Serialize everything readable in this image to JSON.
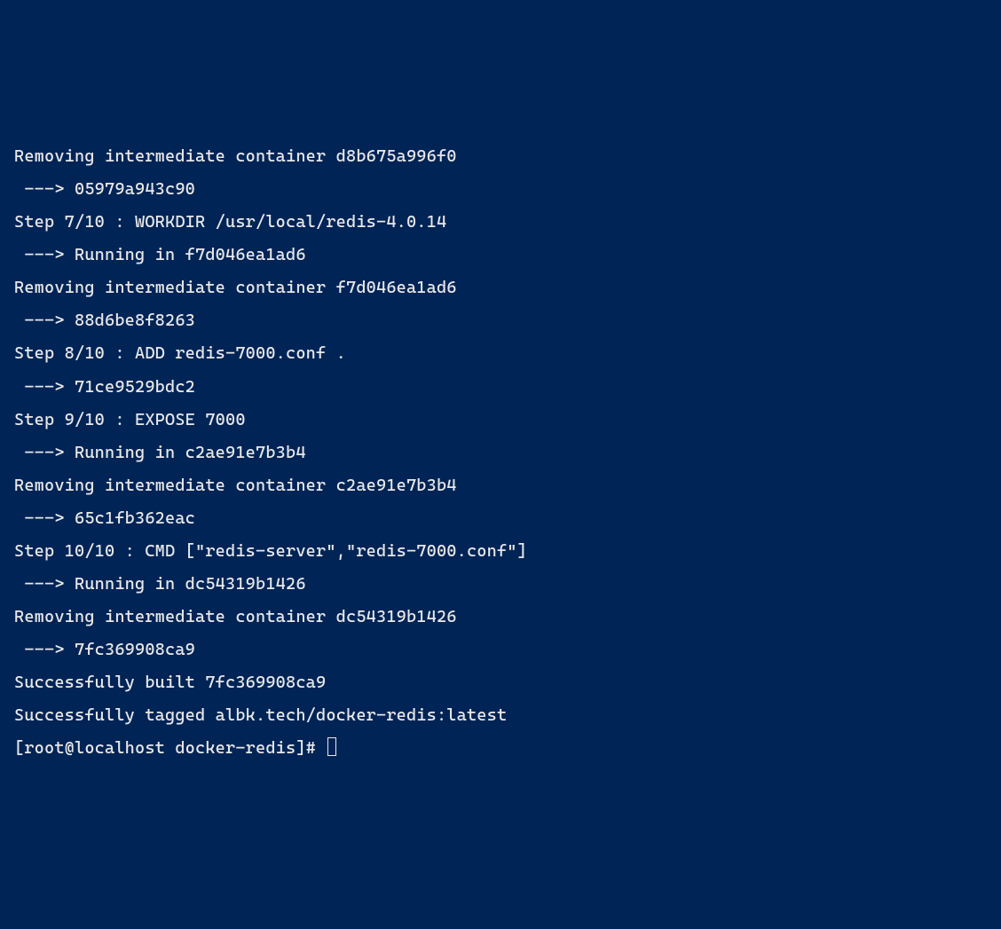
{
  "terminal": {
    "lines": [
      "Removing intermediate container d8b675a996f0",
      " ---> 05979a943c90",
      "Step 7/10 : WORKDIR /usr/local/redis-4.0.14",
      " ---> Running in f7d046ea1ad6",
      "Removing intermediate container f7d046ea1ad6",
      " ---> 88d6be8f8263",
      "Step 8/10 : ADD redis-7000.conf .",
      " ---> 71ce9529bdc2",
      "Step 9/10 : EXPOSE 7000",
      " ---> Running in c2ae91e7b3b4",
      "Removing intermediate container c2ae91e7b3b4",
      " ---> 65c1fb362eac",
      "Step 10/10 : CMD [\"redis-server\",\"redis-7000.conf\"]",
      " ---> Running in dc54319b1426",
      "Removing intermediate container dc54319b1426",
      " ---> 7fc369908ca9",
      "Successfully built 7fc369908ca9",
      "Successfully tagged albk.tech/docker-redis:latest"
    ],
    "prompt": "[root@localhost docker-redis]# "
  }
}
